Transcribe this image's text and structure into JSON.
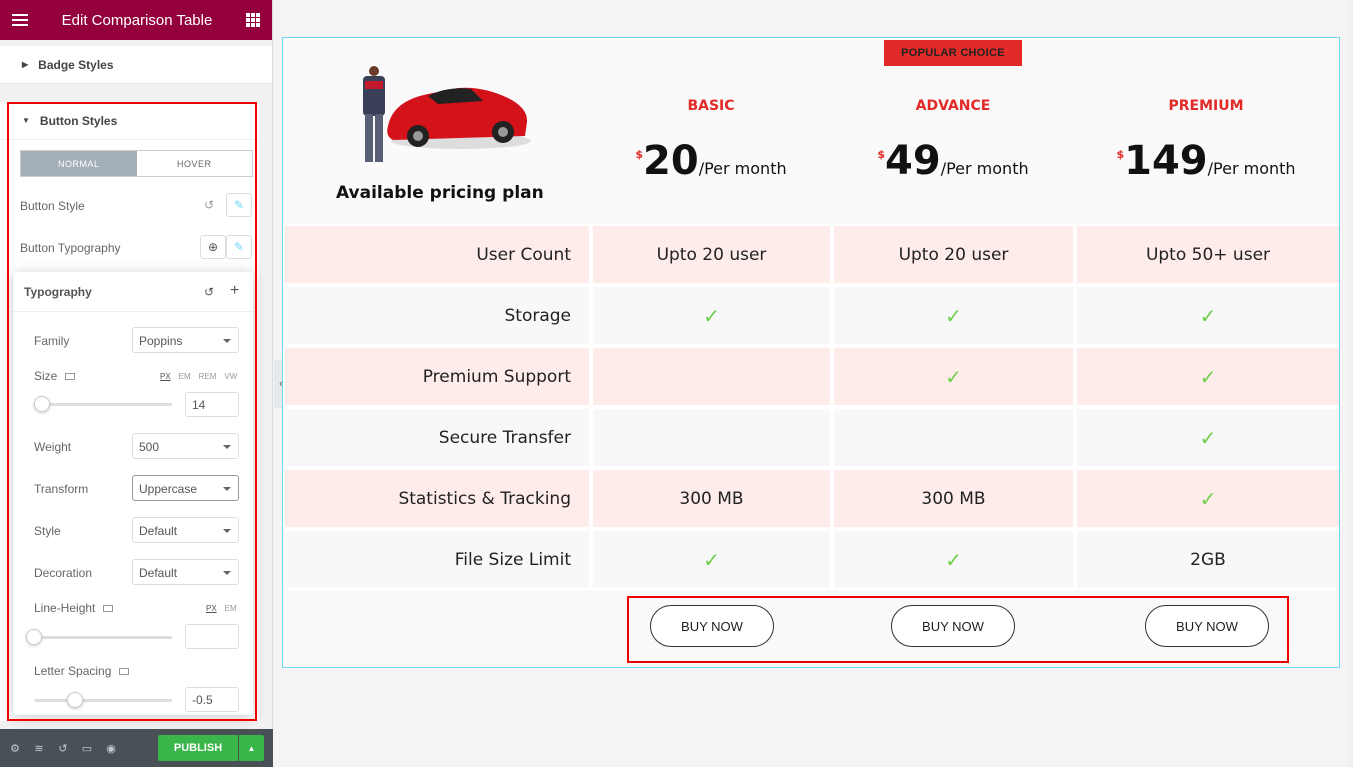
{
  "sidebar": {
    "title": "Edit Comparison Table",
    "badge_section": "Badge Styles",
    "button_section": "Button Styles",
    "tabs": [
      "NORMAL",
      "HOVER"
    ],
    "button_style_label": "Button Style",
    "button_typography_label": "Button Typography",
    "typography": {
      "heading": "Typography",
      "family_label": "Family",
      "family_value": "Poppins",
      "size_label": "Size",
      "size_units": [
        "PX",
        "EM",
        "REM",
        "VW"
      ],
      "size_value": "14",
      "weight_label": "Weight",
      "weight_value": "500",
      "transform_label": "Transform",
      "transform_value": "Uppercase",
      "style_label": "Style",
      "style_value": "Default",
      "decoration_label": "Decoration",
      "decoration_value": "Default",
      "line_height_label": "Line-Height",
      "line_height_units": [
        "PX",
        "EM"
      ],
      "line_height_value": "",
      "letter_spacing_label": "Letter Spacing",
      "letter_spacing_value": "-0.5"
    },
    "publish_label": "PUBLISH"
  },
  "pricing": {
    "badge": "POPULAR CHOICE",
    "heading": "Available pricing plan",
    "plans": [
      {
        "name": "BASIC",
        "currency": "$",
        "amount": "20",
        "period": "/Per month"
      },
      {
        "name": "ADVANCE",
        "currency": "$",
        "amount": "49",
        "period": "/Per month"
      },
      {
        "name": "PREMIUM",
        "currency": "$",
        "amount": "149",
        "period": "/Per month"
      }
    ],
    "rows": [
      {
        "feature": "User Count",
        "values": [
          "Upto 20 user",
          "Upto 20 user",
          "Upto 50+ user"
        ]
      },
      {
        "feature": "Storage",
        "values": [
          "check",
          "check",
          "check"
        ]
      },
      {
        "feature": "Premium Support",
        "values": [
          "",
          "check",
          "check"
        ]
      },
      {
        "feature": "Secure Transfer",
        "values": [
          "",
          "",
          "check"
        ]
      },
      {
        "feature": "Statistics & Tracking",
        "values": [
          "300 MB",
          "300 MB",
          "check"
        ]
      },
      {
        "feature": "File Size Limit",
        "values": [
          "check",
          "check",
          "2GB"
        ]
      }
    ],
    "buy_label": "BUY NOW"
  },
  "colors": {
    "brand": "#93003c",
    "accent": "#e22a28",
    "check": "#6ecf4b",
    "publish": "#39b54a"
  }
}
